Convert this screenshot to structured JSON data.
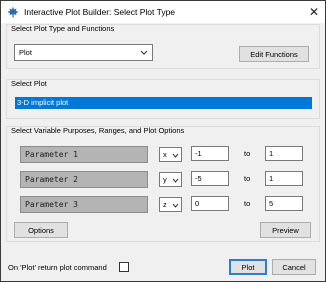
{
  "window": {
    "title": "Interactive Plot Builder: Select Plot Type",
    "close_glyph": "✕"
  },
  "plot_type_group": {
    "label": "Select Plot Type and Functions",
    "plot_type_value": "Plot",
    "edit_functions_label": "Edit Functions"
  },
  "select_plot_group": {
    "label": "Select Plot",
    "selected_item": "3-D implicit plot"
  },
  "variables_group": {
    "label": "Select Variable Purposes, Ranges, and Plot Options",
    "rows": [
      {
        "param": "Parameter 1",
        "axis": "x",
        "from": "-1",
        "to_label": "to",
        "to": "1"
      },
      {
        "param": "Parameter 2",
        "axis": "y",
        "from": "-5",
        "to_label": "to",
        "to": "1"
      },
      {
        "param": "Parameter 3",
        "axis": "z",
        "from": "0",
        "to_label": "to",
        "to": "5"
      }
    ],
    "options_label": "Options",
    "preview_label": "Preview"
  },
  "footer": {
    "return_label": "On 'Plot' return plot command",
    "return_checked": false,
    "plot_label": "Plot",
    "cancel_label": "Cancel"
  }
}
